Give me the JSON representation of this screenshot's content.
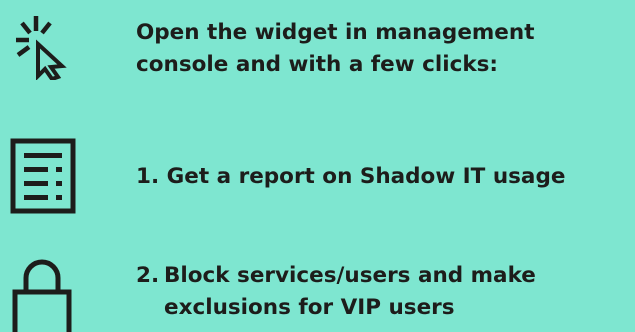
{
  "intro": {
    "line1": "Open the widget in management",
    "line2": "console and with a few clicks:"
  },
  "steps": [
    {
      "text": "1. Get a report on Shadow IT usage"
    },
    {
      "number": "2.",
      "line1": "Block services/users and make",
      "line2": "exclusions for VIP users"
    }
  ],
  "icons": {
    "intro": "cursor-click-icon",
    "step1": "report-document-icon",
    "step2": "lock-icon"
  },
  "colors": {
    "background": "#7ee6d0",
    "text": "#1d1d1b"
  }
}
